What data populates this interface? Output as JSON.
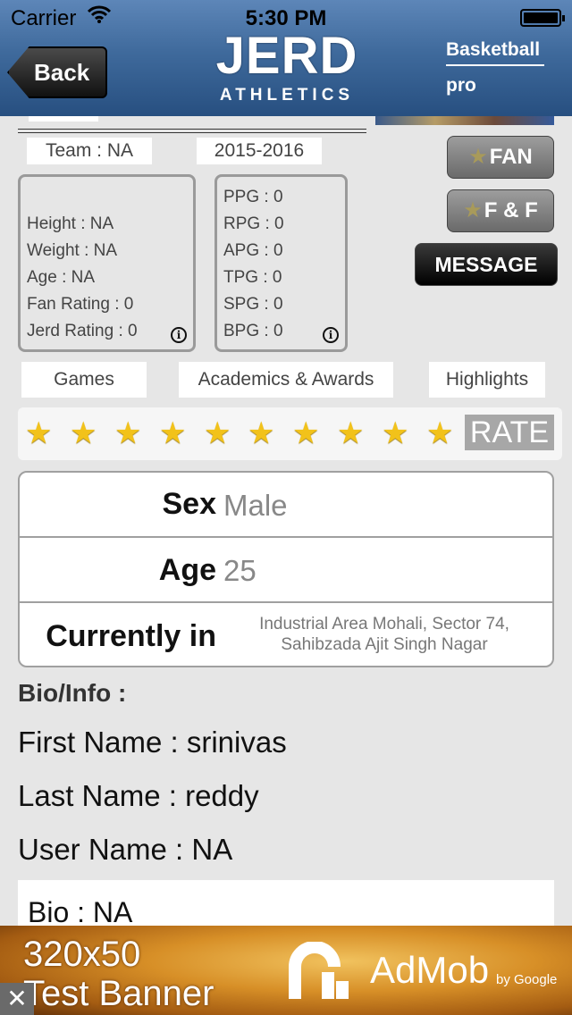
{
  "status": {
    "carrier": "Carrier",
    "time": "5:30 PM"
  },
  "nav": {
    "back_label": "Back",
    "logo_main": "JERD",
    "logo_sub": "ATHLETICS",
    "sport": "Basketball",
    "level": "pro"
  },
  "profile": {
    "team": "Team : NA",
    "season": "2015-2016",
    "personal": [
      "Height : NA",
      "Weight : NA",
      "Age : NA",
      "Fan Rating : 0",
      "Jerd Rating : 0"
    ],
    "stats": [
      "PPG : 0",
      "RPG : 0",
      "APG : 0",
      "TPG : 0",
      "SPG : 0",
      "BPG : 0"
    ],
    "info_icon": "i"
  },
  "actions": {
    "fan": "FAN",
    "ff": "F & F",
    "message": "MESSAGE",
    "star_glyph": "★"
  },
  "tabs": [
    "Games",
    "Academics & Awards",
    "Highlights"
  ],
  "rating": {
    "stars": 10,
    "star_glyph": "★",
    "rate_label": "RATE"
  },
  "details": [
    {
      "label": "Sex",
      "value": "Male"
    },
    {
      "label": "Age",
      "value": "25"
    },
    {
      "label": "Currently in",
      "value": "Industrial Area Mohali, Sector 74, Sahibzada Ajit Singh Nagar"
    }
  ],
  "bio": {
    "title": "Bio/Info :",
    "first_name": "First Name : srinivas",
    "last_name": "Last Name : reddy",
    "user_name": "User Name : NA",
    "bio": "Bio : NA"
  },
  "ad": {
    "line1": "320x50",
    "line2": "Test Banner",
    "brand": "AdMob",
    "by": "by Google",
    "close": "✕"
  }
}
